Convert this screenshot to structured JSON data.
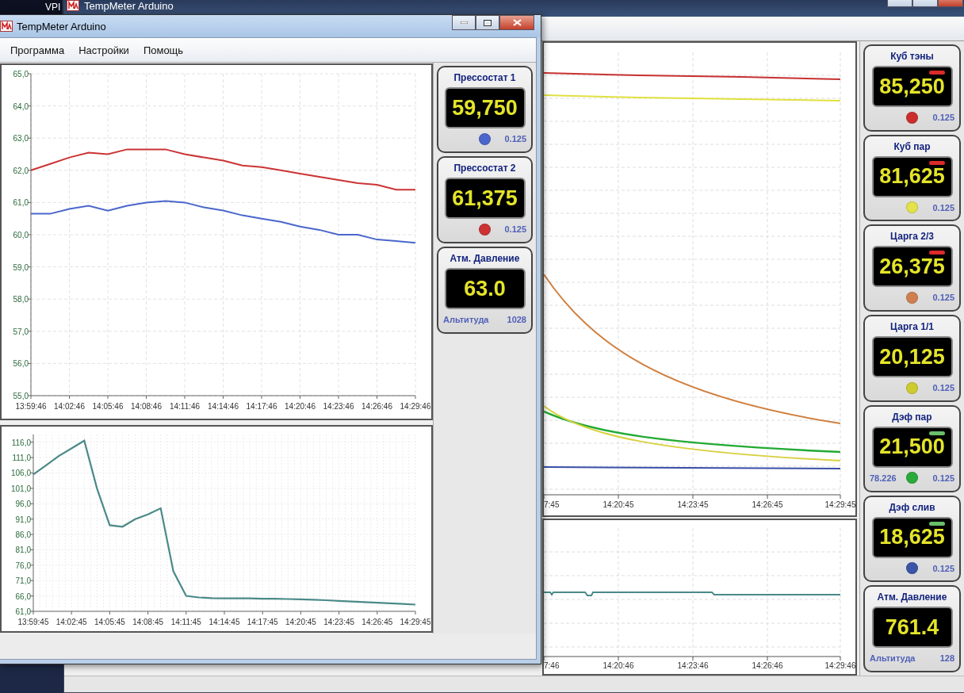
{
  "desktop": {
    "background_window_text": "VPI"
  },
  "back_window": {
    "title": "TempMeter Arduino",
    "main_chart_x_labels": [
      "7:45",
      "14:20:45",
      "14:23:45",
      "14:26:45",
      "14:29:45"
    ],
    "lower_chart_x_labels": [
      "7:46",
      "14:20:46",
      "14:23:46",
      "14:26:46",
      "14:29:46"
    ],
    "gauges": [
      {
        "kind": "sensor",
        "title": "Куб тэны",
        "value": "85,250",
        "alarm": true,
        "color": "#cc2e2e",
        "step": "0.125"
      },
      {
        "kind": "sensor",
        "title": "Куб пар",
        "value": "81,625",
        "alarm": true,
        "color": "#e2e24a",
        "step": "0.125"
      },
      {
        "kind": "sensor",
        "title": "Царга 2/3",
        "value": "26,375",
        "alarm": true,
        "color": "#d08050",
        "step": "0.125"
      },
      {
        "kind": "sensor",
        "title": "Царга 1/1",
        "value": "20,125",
        "color": "#cccc30",
        "step": "0.125"
      },
      {
        "kind": "sensor",
        "title": "Дэф пар",
        "value": "21,500",
        "alarm": false,
        "reading": "78.226",
        "color": "#2aaa3a",
        "step": "0.125"
      },
      {
        "kind": "sensor",
        "title": "Дэф слив",
        "value": "18,625",
        "alarm": false,
        "color": "#3a55a8",
        "step": "0.125"
      },
      {
        "kind": "pressure",
        "title": "Атм. Давление",
        "value": "761.4",
        "altitude_label": "Альтитуда",
        "altitude": "128"
      }
    ]
  },
  "window": {
    "title": "TempMeter Arduino",
    "menu": [
      {
        "label": "Программа"
      },
      {
        "label": "Настройки"
      },
      {
        "label": "Помощь"
      }
    ],
    "top_chart": {
      "chart_data": {
        "type": "line",
        "categories": [
          "13:59:46",
          null,
          "14:02:46",
          null,
          "14:05:46",
          null,
          "14:08:46",
          null,
          "14:11:46",
          null,
          "14:14:46",
          null,
          "14:17:46",
          null,
          "14:20:46",
          null,
          "14:23:46",
          null,
          "14:26:46",
          null,
          "14:29:46"
        ],
        "series": [
          {
            "color": "#cc3333",
            "values": [
              62.0,
              62.2,
              62.4,
              62.55,
              62.5,
              62.65,
              62.65,
              62.65,
              62.5,
              62.4,
              62.3,
              62.15,
              62.1,
              62.0,
              61.9,
              61.8,
              61.7,
              61.6,
              61.55,
              61.4,
              61.4
            ]
          },
          {
            "color": "#4a66cc",
            "values": [
              60.65,
              60.65,
              60.8,
              60.9,
              60.75,
              60.9,
              61.0,
              61.05,
              61.0,
              60.85,
              60.75,
              60.6,
              60.5,
              60.4,
              60.25,
              60.15,
              60.0,
              60.0,
              59.85,
              59.8,
              59.75
            ]
          }
        ],
        "ylim": [
          55,
          65
        ],
        "grid": true,
        "yticks": [
          {
            "value": 55,
            "label": "55,0"
          },
          {
            "value": 56,
            "label": "56,0"
          },
          {
            "value": 57,
            "label": "57,0"
          },
          {
            "value": 58,
            "label": "58,0"
          },
          {
            "value": 59,
            "label": "59,0"
          },
          {
            "value": 60,
            "label": "60,0"
          },
          {
            "value": 61,
            "label": "61,0"
          },
          {
            "value": 62,
            "label": "62,0"
          },
          {
            "value": 63,
            "label": "63,0"
          },
          {
            "value": 64,
            "label": "64,0"
          },
          {
            "value": 65,
            "label": "65,0"
          }
        ]
      }
    },
    "bottom_chart": {
      "chart_data": {
        "type": "line",
        "categories": [
          "13:59:45",
          null,
          null,
          "14:02:45",
          null,
          null,
          "14:05:45",
          null,
          null,
          "14:08:45",
          null,
          null,
          "14:11:45",
          null,
          null,
          "14:14:45",
          null,
          null,
          "14:17:45",
          null,
          null,
          "14:20:45",
          null,
          null,
          "14:23:45",
          null,
          null,
          "14:26:45",
          null,
          null,
          "14:29:45"
        ],
        "series": [
          {
            "color": "#4a8a88",
            "values": [
              105.5,
              108.5,
              111.5,
              114,
              116.5,
              101,
              89,
              88.5,
              91,
              92.5,
              94.5,
              74,
              66,
              65.5,
              65.3,
              65.2,
              65.2,
              65.2,
              65.1,
              65.1,
              65.0,
              64.9,
              64.8,
              64.6,
              64.4,
              64.2,
              64.0,
              63.8,
              63.6,
              63.4,
              63.2
            ]
          }
        ],
        "ylim": [
          61,
          118.5
        ],
        "grid": true,
        "yticks": [
          {
            "value": 61,
            "label": "61,0"
          },
          {
            "value": 66,
            "label": "66,0"
          },
          {
            "value": 71,
            "label": "71,0"
          },
          {
            "value": 76,
            "label": "76,0"
          },
          {
            "value": 81,
            "label": "81,0"
          },
          {
            "value": 86,
            "label": "86,0"
          },
          {
            "value": 91,
            "label": "91,0"
          },
          {
            "value": 96,
            "label": "96,0"
          },
          {
            "value": 101,
            "label": "101,0"
          },
          {
            "value": 106,
            "label": "106,0"
          },
          {
            "value": 111,
            "label": "111,0"
          },
          {
            "value": 116,
            "label": "116,0"
          }
        ]
      }
    },
    "gauges": [
      {
        "kind": "sensor",
        "title": "Прессостат 1",
        "value": "59,750",
        "color": "#4a66cc",
        "step": "0.125"
      },
      {
        "kind": "sensor",
        "title": "Прессостат 2",
        "value": "61,375",
        "color": "#cc3333",
        "step": "0.125"
      },
      {
        "kind": "pressure",
        "title": "Атм. Давление",
        "value": "63.0",
        "altitude_label": "Альтитуда",
        "altitude": "1028"
      }
    ]
  }
}
